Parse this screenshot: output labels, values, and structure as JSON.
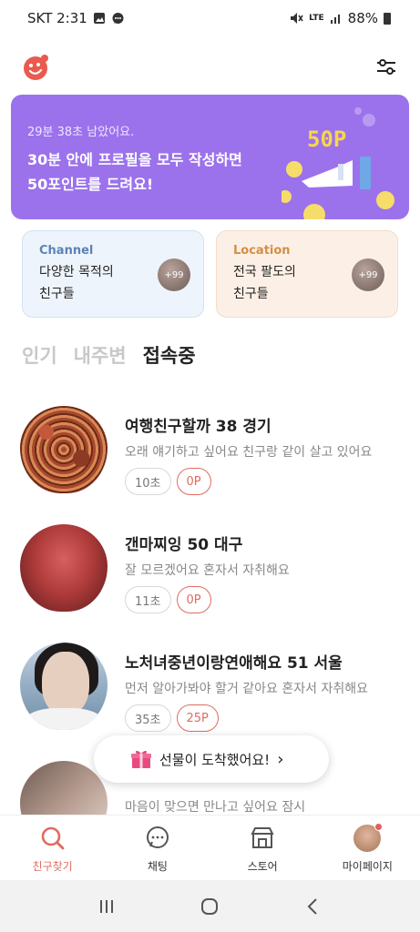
{
  "status_bar": {
    "carrier_time": "SKT 2:31",
    "network": "LTE",
    "battery": "88%",
    "icons": [
      "image-icon",
      "message-icon",
      "mute-icon",
      "signal-icon",
      "battery-icon"
    ]
  },
  "header": {
    "logo_icon": "logo-icon",
    "filter_icon": "filter-sliders-icon"
  },
  "banner": {
    "timer": "29분 38초 남았어요.",
    "line1": "30분 안에 프로필을 모두 작성하면",
    "line2": "50포인트를 드려요!",
    "points_label": "50P",
    "color": "#9b72ec"
  },
  "cards": [
    {
      "eyebrow": "Channel",
      "line1": "다양한 목적의",
      "line2": "친구들",
      "badge": "+99"
    },
    {
      "eyebrow": "Location",
      "line1": "전국 팔도의",
      "line2": "친구들",
      "badge": "+99"
    }
  ],
  "tabs": [
    {
      "label": "인기",
      "active": false
    },
    {
      "label": "내주변",
      "active": false
    },
    {
      "label": "접속중",
      "active": true
    }
  ],
  "users": [
    {
      "name": "여행친구할까 38 경기",
      "desc": "오래 얘기하고 싶어요 친구랑 같이 살고 있어요",
      "time": "10초",
      "points": "0P"
    },
    {
      "name": "갠마찌잉 50 대구",
      "desc": "잘 모르겠어요 혼자서 자취해요",
      "time": "11초",
      "points": "0P"
    },
    {
      "name": "노처녀중년이랑연애해요 51 서울",
      "desc": "먼저 알아가봐야 할거 같아요 혼자서 자취해요",
      "time": "35초",
      "points": "25P"
    },
    {
      "name": "",
      "desc": "마음이 맞으면 만나고 싶어요 잠시",
      "time": "",
      "points": ""
    }
  ],
  "toast": {
    "label": "선물이 도착했어요!",
    "chevron": "›"
  },
  "bottom_nav": [
    {
      "label": "친구찾기",
      "icon": "search-icon",
      "active": true
    },
    {
      "label": "채팅",
      "icon": "chat-icon",
      "active": false
    },
    {
      "label": "스토어",
      "icon": "store-icon",
      "active": false
    },
    {
      "label": "마이페이지",
      "icon": "avatar",
      "active": false
    }
  ],
  "accent_color": "#e06b5f"
}
